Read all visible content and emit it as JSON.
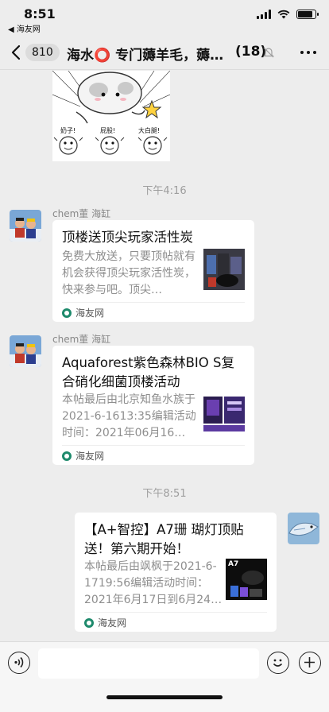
{
  "status_bar": {
    "time": "8:51",
    "back_app": "◀ 海友网"
  },
  "nav": {
    "unread_count": "810",
    "title": "海水⭕ 专门薅羊毛，薅…",
    "member_count": "(18)"
  },
  "messages": {
    "sticker": {
      "captions": [
        "奶子!",
        "屁股!",
        "大白腿!"
      ]
    },
    "time1": "下午4:16",
    "card1": {
      "sender": "chem董 海缸",
      "title": "顶楼送顶尖玩家活性炭",
      "desc": "免费大放送，只要顶帖就有机会获得顶尖玩家活性炭，快来参与吧。顶尖…",
      "source": "海友网"
    },
    "card2": {
      "sender": "chem董 海缸",
      "title": "Aquaforest紫色森林BIO S复合硝化细菌顶楼活动",
      "desc": "本帖最后由北京知鱼水族于2021-6-1613:35编辑活动时间：2021年06月16…",
      "source": "海友网"
    },
    "time2": "下午8:51",
    "card3": {
      "title": "【A+智控】A7珊 瑚灯顶贴送！第六期开始！",
      "desc": "本帖最后由飒枫于2021-6-1719:56编辑活动时间：2021年6月17日到6月24…",
      "thumb_label": "A7",
      "source": "海友网"
    }
  },
  "colors": {
    "background": "#ededed",
    "card": "#ffffff",
    "muted_text": "#8e8e8e",
    "source_icon": "#1e8a6c"
  }
}
